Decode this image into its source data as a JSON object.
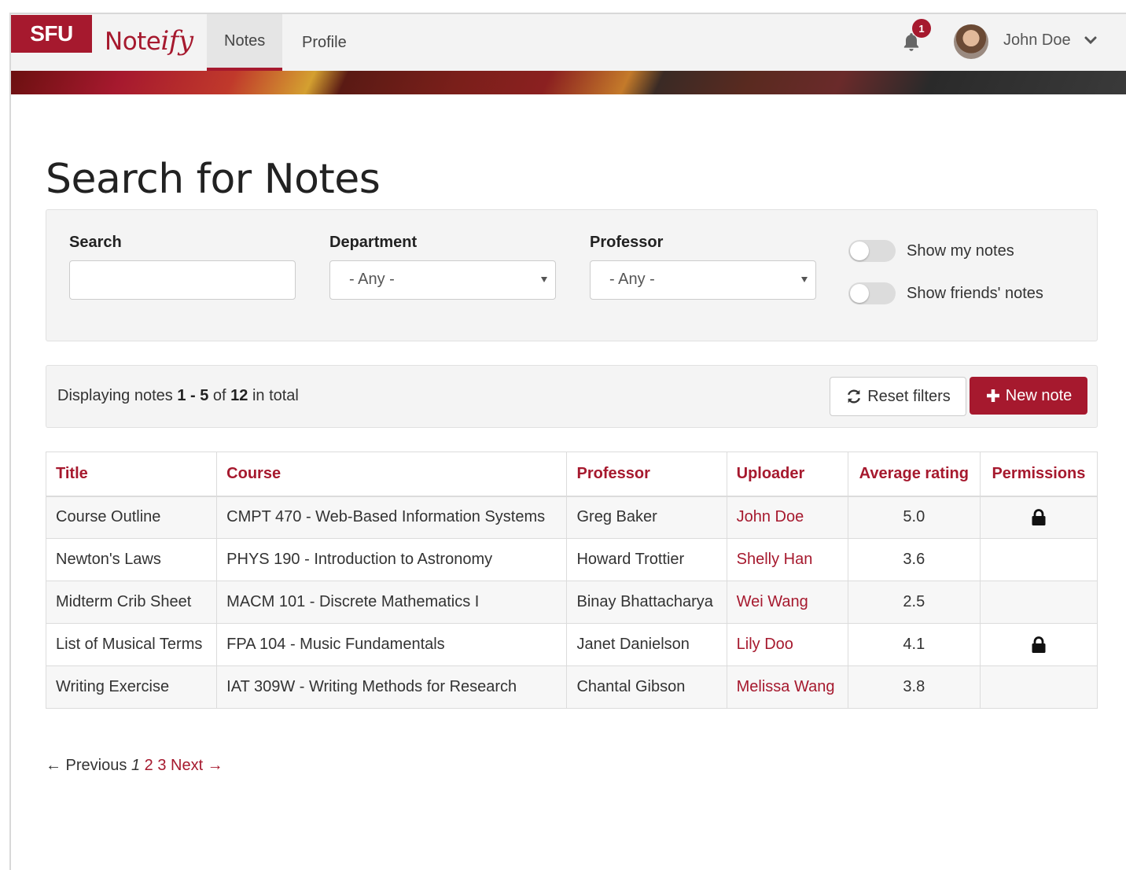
{
  "brand": {
    "sfu": "SFU",
    "name_prefix": "Note",
    "name_script": "ify",
    "color": "#a6192e"
  },
  "nav": {
    "tabs": [
      {
        "label": "Notes",
        "active": true
      },
      {
        "label": "Profile",
        "active": false
      }
    ],
    "notifications_count": "1",
    "user_name": "John Doe"
  },
  "page_title": "Search for Notes",
  "filters": {
    "search_label": "Search",
    "search_value": "",
    "department_label": "Department",
    "department_value": "- Any -",
    "professor_label": "Professor",
    "professor_value": "- Any -",
    "toggles": [
      {
        "label": "Show my notes",
        "on": false
      },
      {
        "label": "Show friends' notes",
        "on": false
      }
    ]
  },
  "results": {
    "prefix": "Displaying notes ",
    "range": "1 - 5",
    "of": " of ",
    "total": "12",
    "suffix": " in total",
    "reset_label": "Reset filters",
    "new_label": "New note"
  },
  "table": {
    "headers": [
      "Title",
      "Course",
      "Professor",
      "Uploader",
      "Average rating",
      "Permissions"
    ],
    "rows": [
      {
        "title": "Course Outline",
        "course": "CMPT 470 - Web-Based Information Systems",
        "professor": "Greg Baker",
        "uploader": "John Doe",
        "rating": "5.0",
        "locked": true
      },
      {
        "title": "Newton's Laws",
        "course": "PHYS 190 - Introduction to Astronomy",
        "professor": "Howard Trottier",
        "uploader": "Shelly Han",
        "rating": "3.6",
        "locked": false
      },
      {
        "title": "Midterm Crib Sheet",
        "course": "MACM 101 - Discrete Mathematics I",
        "professor": "Binay Bhattacharya",
        "uploader": "Wei Wang",
        "rating": "2.5",
        "locked": false
      },
      {
        "title": "List of Musical Terms",
        "course": "FPA 104 - Music Fundamentals",
        "professor": "Janet Danielson",
        "uploader": "Lily Doo",
        "rating": "4.1",
        "locked": true
      },
      {
        "title": "Writing Exercise",
        "course": "IAT 309W - Writing Methods for Research",
        "professor": "Chantal Gibson",
        "uploader": "Melissa Wang",
        "rating": "3.8",
        "locked": false
      }
    ]
  },
  "pager": {
    "previous": "← Previous",
    "current": "1",
    "pages": [
      "2",
      "3"
    ],
    "next": "Next →"
  }
}
